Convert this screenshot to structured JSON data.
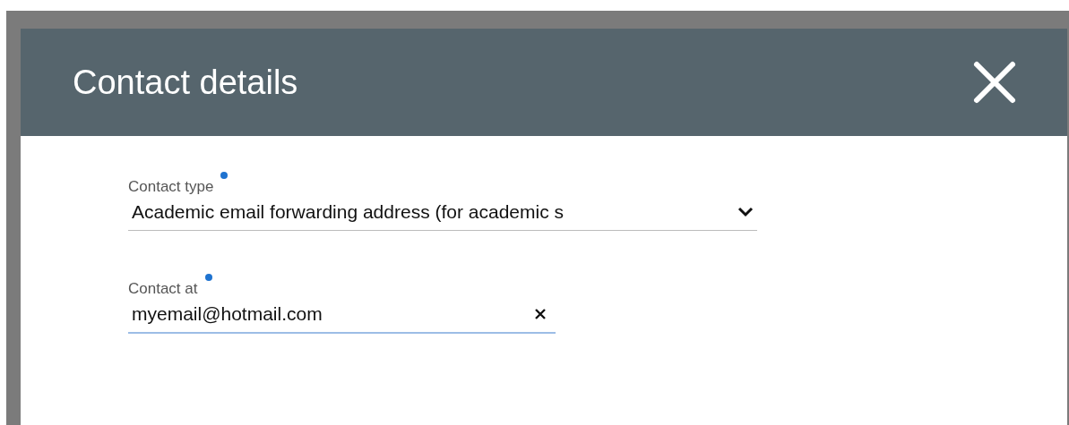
{
  "dialog": {
    "title": "Contact details"
  },
  "fields": [
    {
      "kind": "select",
      "label": "Contact type",
      "required": true,
      "value": "Academic email forwarding address (for academic s",
      "focused": false
    },
    {
      "kind": "text",
      "label": "Contact at",
      "required": true,
      "value": "myemail@hotmail.com",
      "focused": true
    }
  ]
}
